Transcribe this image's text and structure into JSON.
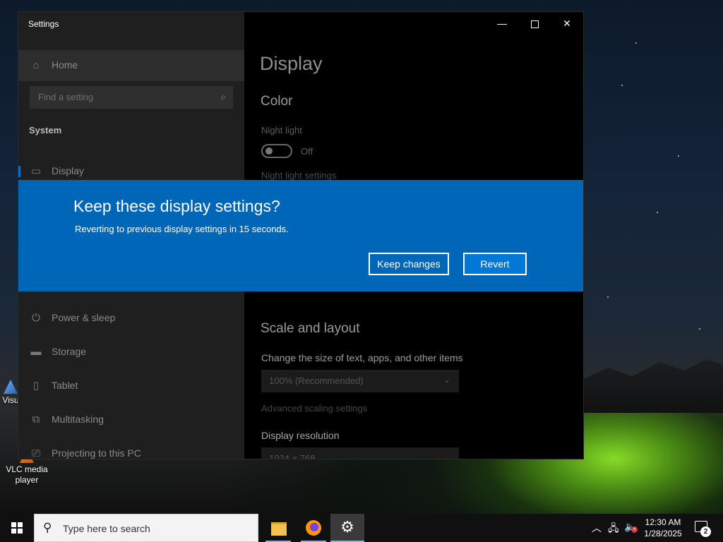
{
  "desktop": {
    "icons": [
      {
        "label": "Visu"
      },
      {
        "label": "VLC media player"
      }
    ]
  },
  "settings_window": {
    "title": "Settings",
    "sidebar": {
      "home_label": "Home",
      "search_placeholder": "Find a setting",
      "section_label": "System",
      "items": [
        {
          "label": "Display",
          "icon": "monitor-icon",
          "selected": true
        },
        {
          "label": "Power & sleep",
          "icon": "power-icon"
        },
        {
          "label": "Storage",
          "icon": "storage-icon"
        },
        {
          "label": "Tablet",
          "icon": "tablet-icon"
        },
        {
          "label": "Multitasking",
          "icon": "multitasking-icon"
        },
        {
          "label": "Projecting to this PC",
          "icon": "projecting-icon"
        }
      ]
    },
    "content": {
      "page_title": "Display",
      "color_heading": "Color",
      "night_light_label": "Night light",
      "night_light_state": "Off",
      "night_light_settings_link": "Night light settings",
      "scale_heading": "Scale and layout",
      "scale_description": "Change the size of text, apps, and other items",
      "scale_value": "100% (Recommended)",
      "advanced_scaling_link": "Advanced scaling settings",
      "resolution_label": "Display resolution",
      "resolution_value": "1024 × 768"
    }
  },
  "dialog": {
    "title": "Keep these display settings?",
    "message": "Reverting to previous display settings in 15 seconds.",
    "keep_button": "Keep changes",
    "revert_button": "Revert",
    "accent_color": "#0067b8"
  },
  "taskbar": {
    "search_placeholder": "Type here to search",
    "apps": [
      {
        "name": "file-explorer-icon"
      },
      {
        "name": "firefox-icon"
      },
      {
        "name": "settings-gear-icon",
        "active": true
      }
    ],
    "clock_time": "12:30 AM",
    "clock_date": "1/28/2025",
    "notification_count": "2"
  }
}
